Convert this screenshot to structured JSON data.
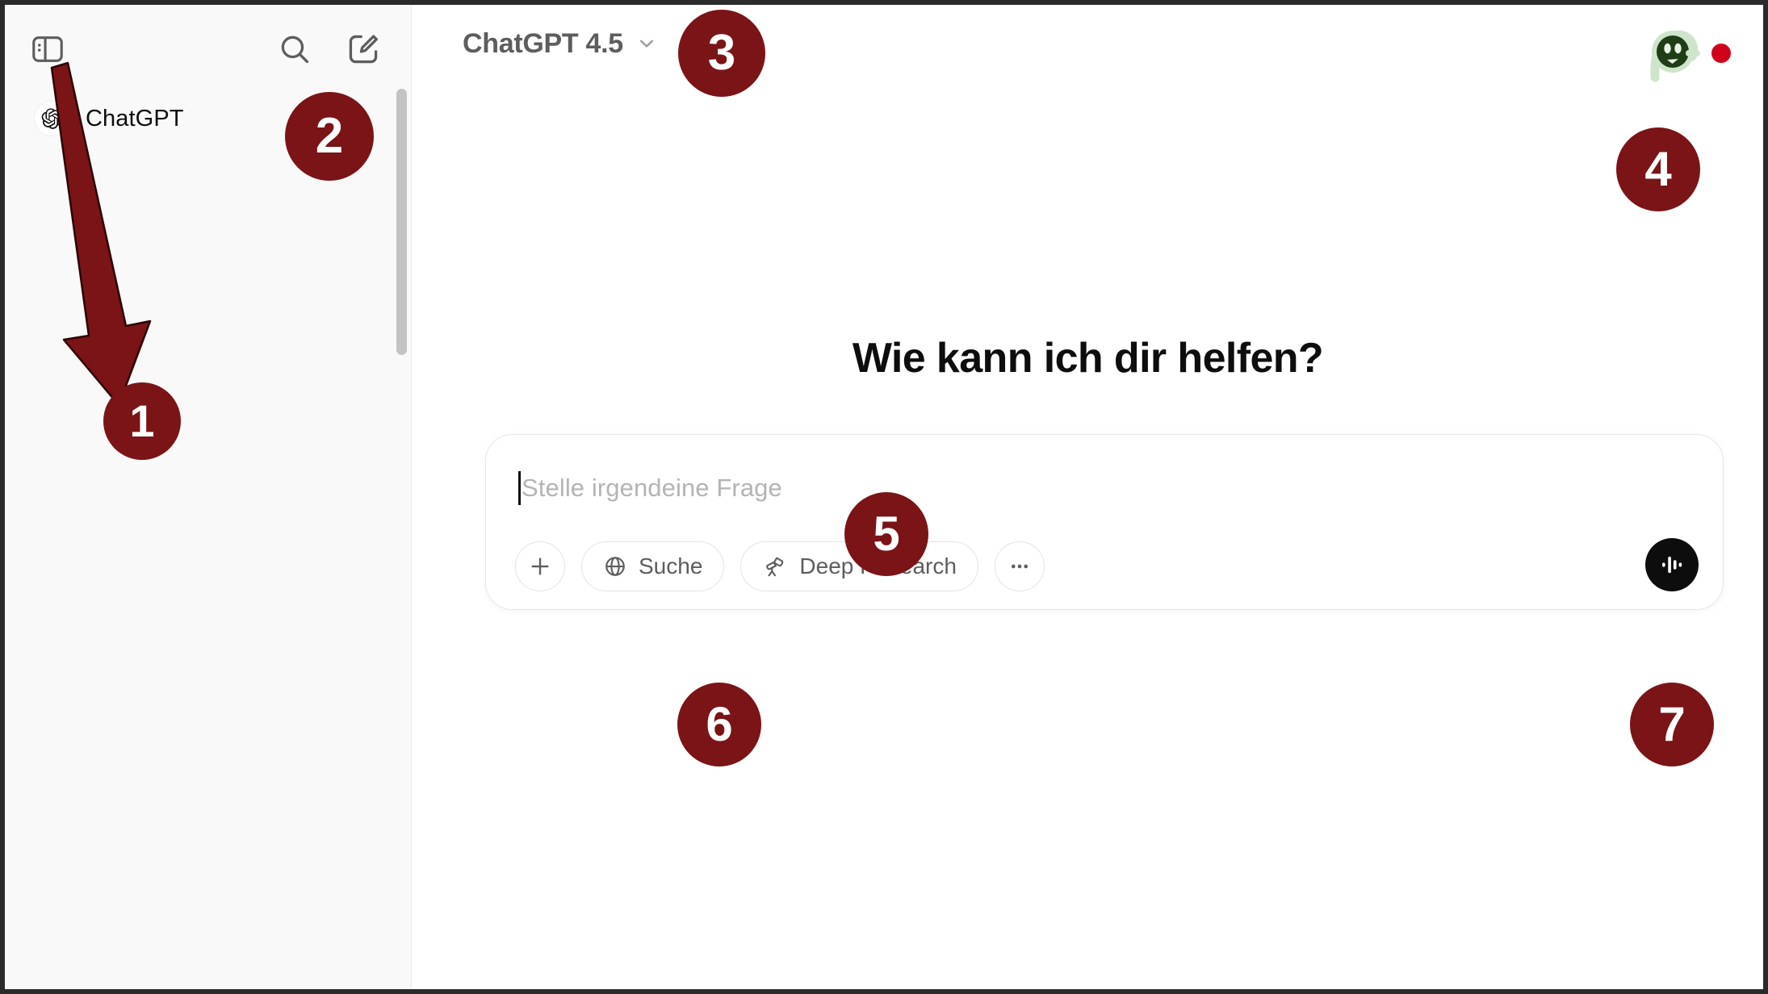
{
  "window": {
    "border_color": "#2b2b2b",
    "background": "#ffffff"
  },
  "sidebar": {
    "background": "#f9f9f9",
    "toggle_button": {
      "name": "sidebar-toggle",
      "icon": "sidebar-toggle-icon"
    },
    "search_button": {
      "name": "search",
      "icon": "search-icon"
    },
    "compose_button": {
      "name": "new-chat",
      "icon": "compose-pencil-icon"
    },
    "items": [
      {
        "label": "ChatGPT",
        "icon": "openai-logo-icon"
      }
    ],
    "scrollbar": {
      "name": "sidebar-scrollbar",
      "thumb_color": "#c3c3c3"
    }
  },
  "header": {
    "model_selector": {
      "label": "ChatGPT 4.5",
      "chevron": "chevron-down-icon"
    },
    "account": {
      "avatar_icon": "user-avatar-icon",
      "avatar_face_color": "#1f3d17",
      "avatar_ring_color": "#cfe5cb",
      "notification_dot_color": "#d0021b"
    }
  },
  "main": {
    "greeting": "Wie kann ich dir helfen?",
    "composer": {
      "placeholder": "Stelle irgendeine Frage",
      "value": "",
      "attach_button": {
        "label": "+",
        "icon": "plus-icon"
      },
      "tools": [
        {
          "label": "Suche",
          "icon": "globe-icon"
        },
        {
          "label": "Deep Research",
          "icon": "telescope-icon"
        }
      ],
      "more_button": {
        "label": "•••",
        "icon": "ellipsis-icon"
      },
      "voice_button": {
        "icon": "voice-waveform-icon",
        "background": "#0d0d0d"
      }
    }
  },
  "annotations": {
    "color": "#7a1417",
    "markers": [
      {
        "id": "1",
        "label": "1"
      },
      {
        "id": "2",
        "label": "2"
      },
      {
        "id": "3",
        "label": "3"
      },
      {
        "id": "4",
        "label": "4"
      },
      {
        "id": "5",
        "label": "5"
      },
      {
        "id": "6",
        "label": "6"
      },
      {
        "id": "7",
        "label": "7"
      }
    ],
    "arrow": {
      "name": "annotation-arrow-to-sidebar-toggle",
      "points_to": "sidebar-toggle"
    }
  }
}
